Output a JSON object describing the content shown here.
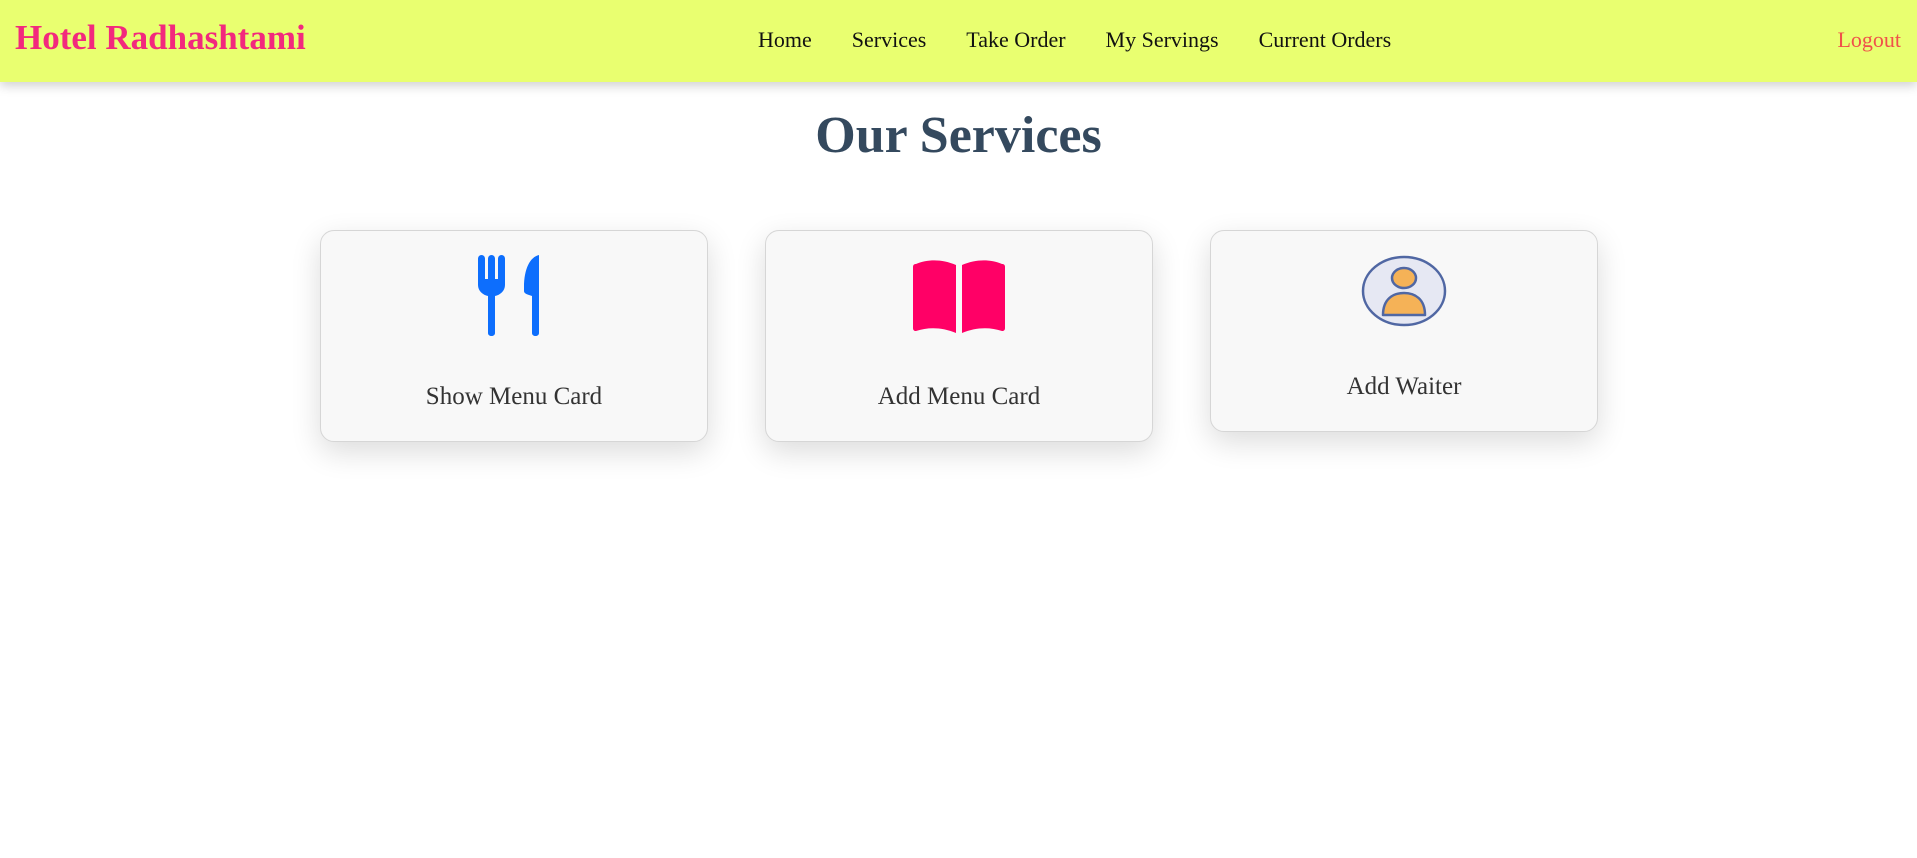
{
  "brand": {
    "name": "Hotel Radhashtami"
  },
  "nav": {
    "links": [
      "Home",
      "Services",
      "Take Order",
      "My Servings",
      "Current Orders"
    ],
    "logout": "Logout"
  },
  "page": {
    "title": "Our Services"
  },
  "services": [
    {
      "label": "Show Menu Card",
      "icon": "fork-knife-icon",
      "color": "#0d6efd"
    },
    {
      "label": "Add Menu Card",
      "icon": "open-book-icon",
      "color": "#ff0066"
    },
    {
      "label": "Add Waiter",
      "icon": "person-avatar-icon",
      "color": "#f5b257"
    }
  ],
  "colors": {
    "navbar_bg": "#e9ff70",
    "brand": "#f2297d",
    "logout": "#f0514a",
    "title": "#34495e"
  }
}
